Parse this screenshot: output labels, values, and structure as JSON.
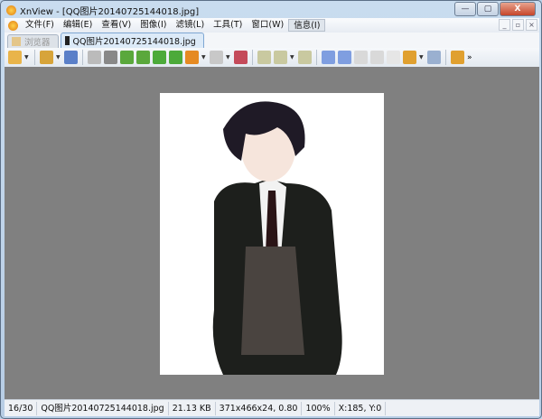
{
  "window": {
    "title": "XnView - [QQ图片20140725144018.jpg]",
    "minimize": "—",
    "maximize": "▢",
    "close": "X"
  },
  "menu": {
    "items": [
      "文件(F)",
      "编辑(E)",
      "查看(V)",
      "图像(I)",
      "滤镜(L)",
      "工具(T)",
      "窗口(W)",
      "信息(I)"
    ],
    "active": "信息(I)",
    "mdi": [
      "_",
      "▫",
      "×"
    ]
  },
  "tabs": [
    {
      "label": "浏览器",
      "active": false
    },
    {
      "label": "QQ图片20140725144018.jpg",
      "active": true
    }
  ],
  "toolbar": {
    "icons": [
      "browser-tree-icon",
      "open-folder-icon",
      "save-icon",
      "undo-icon",
      "crop-icon",
      "rotate-left-icon",
      "rotate-right-icon",
      "flip-vertical-icon",
      "flip-horizontal-icon",
      "convert-icon",
      "adjust-colors-icon",
      "effects-icon",
      "zoom-in-icon",
      "zoom-fit-icon",
      "zoom-out-icon",
      "previous-icon",
      "next-icon",
      "first-page-icon",
      "last-page-icon",
      "copy-icon",
      "slideshow-icon",
      "info-icon",
      "fullscreen-icon"
    ],
    "overflow": "»"
  },
  "image": {
    "description_alt": "anime character image"
  },
  "status": {
    "index": "16/30",
    "filename": "QQ图片20140725144018.jpg",
    "size": "21.13 KB",
    "dims": "371x466x24, 0.80",
    "zoom": "100%",
    "coords": "X:185, Y:0"
  }
}
